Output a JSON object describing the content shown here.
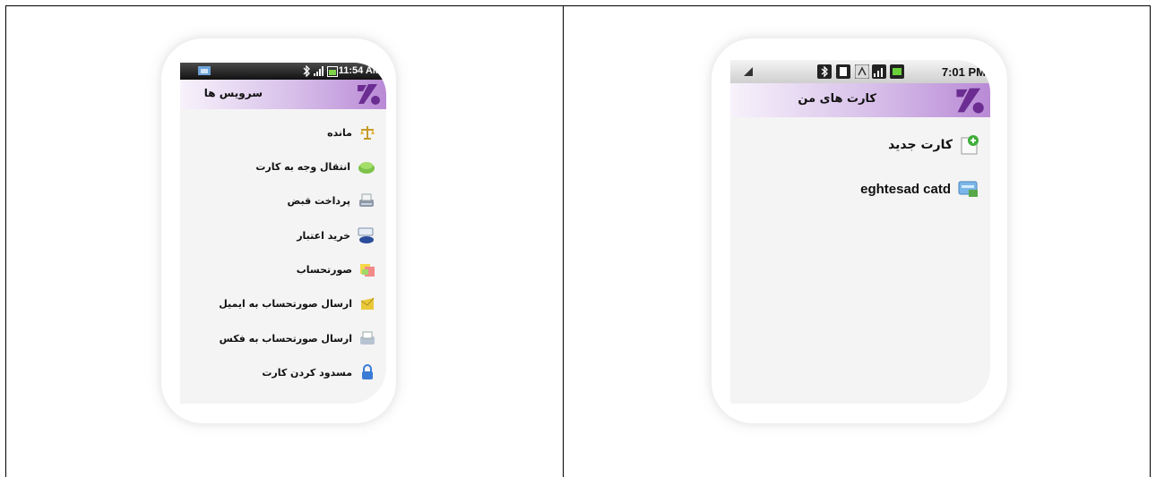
{
  "left_screen": {
    "status_bar": {
      "time": "11:54 AM"
    },
    "header": {
      "title": "سرویس ها"
    },
    "items": [
      {
        "label": "مانده",
        "icon": "scale-icon"
      },
      {
        "label": "انتقال وجه به کارت",
        "icon": "money-icon"
      },
      {
        "label": "پرداخت قبض",
        "icon": "printer-icon"
      },
      {
        "label": "خرید اعتبار",
        "icon": "scratch-card-icon"
      },
      {
        "label": "صورتحساب",
        "icon": "notes-icon"
      },
      {
        "label": "ارسال صورتحساب به ایمیل",
        "icon": "envelope-icon"
      },
      {
        "label": "ارسال صورتحساب به فکس",
        "icon": "fax-icon"
      },
      {
        "label": "مسدود کردن کارت",
        "icon": "lock-icon"
      }
    ]
  },
  "right_screen": {
    "status_bar": {
      "time": "7:01 PM"
    },
    "header": {
      "title": "کارت های من"
    },
    "items": [
      {
        "label": "کارت جدید",
        "icon": "new-card-icon"
      },
      {
        "label": "eghtesad catd",
        "icon": "bank-card-icon"
      }
    ]
  },
  "colors": {
    "header_gradient_end": "#b98ad6",
    "logo": "#6b2d91",
    "list_background": "#f4f4f4"
  }
}
